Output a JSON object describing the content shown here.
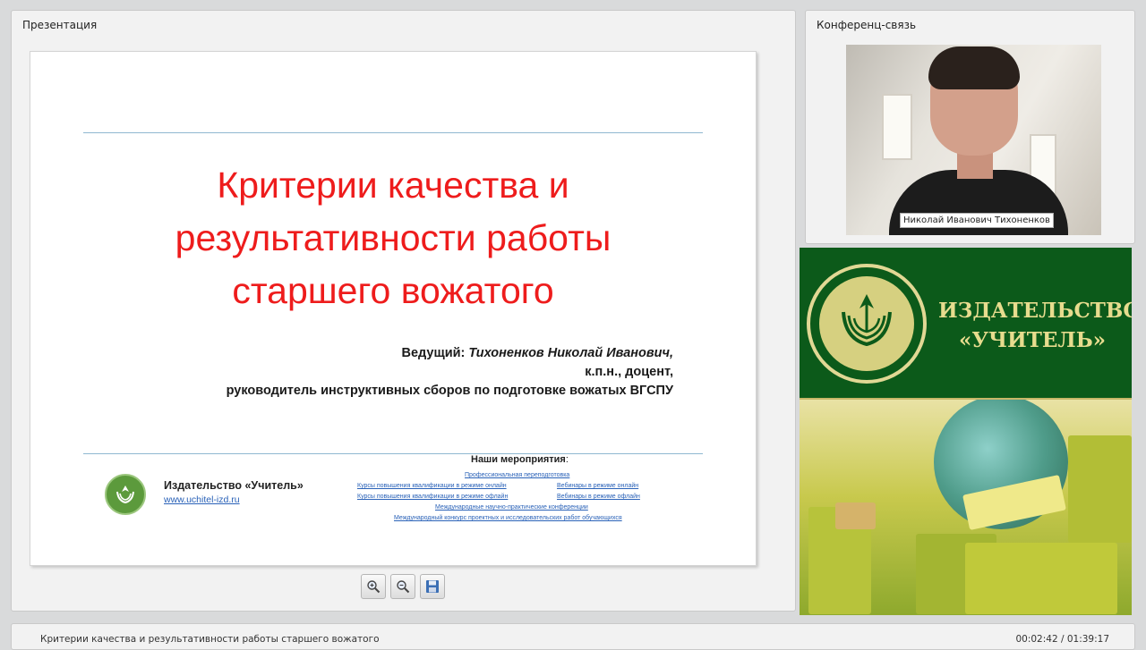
{
  "presentation": {
    "panel_title": "Презентация",
    "slide": {
      "title": "Критерии качества и\nрезультативности работы\nстаршего вожатого",
      "presenter_label": "Ведущий:",
      "presenter_name": "Тихоненков Николай Иванович,",
      "presenter_degree": "к.п.н., доцент,",
      "presenter_role": "руководитель инструктивных сборов по подготовке вожатых ВГСПУ",
      "publisher_name": "Издательство «Учитель»",
      "publisher_url": "www.uchitel-izd.ru",
      "events_heading": "Наши мероприятия",
      "events_heading_suffix": ":",
      "events": [
        "Профессиональная переподготовка",
        "Курсы повышения квалификации в режиме онлайн",
        "Вебинары в режиме онлайн",
        "Курсы повышения квалификации в режиме офлайн",
        "Вебинары в режиме офлайн",
        "Международные научно-практические конференции",
        "Международный конкурс проектных и исследовательских работ обучающихся"
      ]
    },
    "toolbar": {
      "zoom_in_icon": "zoom-in-icon",
      "zoom_out_icon": "zoom-out-icon",
      "save_icon": "floppy-disk-icon"
    }
  },
  "conference": {
    "panel_title": "Конференц-связь",
    "participant_name": "Николай Иванович Тихоненков"
  },
  "banner": {
    "title": "ИЗДАТЕЛЬСТВО\n«УЧИТЕЛЬ»"
  },
  "status_bar": {
    "title": "Критерии качества и результативности работы старшего вожатого",
    "time": "00:02:42 / 01:39:17"
  },
  "colors": {
    "slide_title": "#ee1c1c",
    "link": "#2a62b8",
    "banner_green": "#0c5a1a",
    "banner_gold": "#e7dc8e"
  }
}
